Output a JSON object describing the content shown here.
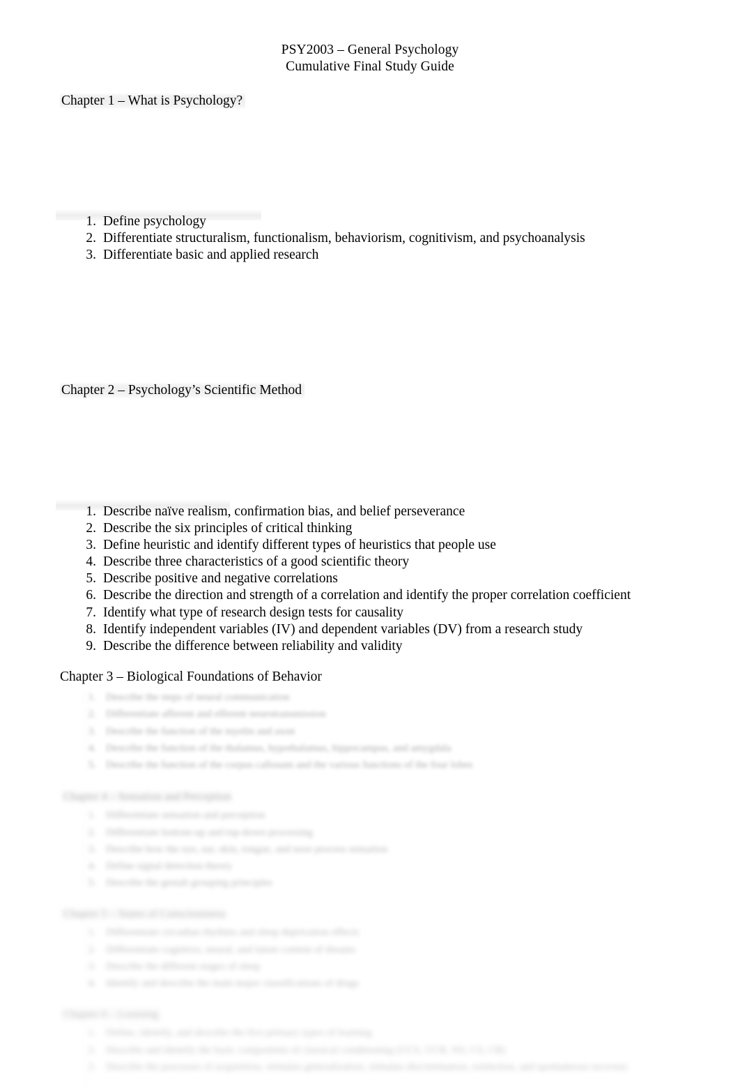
{
  "document": {
    "title_line_1": "PSY2003 – General Psychology",
    "title_line_2": "Cumulative Final Study Guide"
  },
  "chapters": [
    {
      "heading": "Chapter 1 – What is Psychology?",
      "legible": true,
      "objectives": [
        {
          "num": "1.",
          "text": "Define psychology"
        },
        {
          "num": "2.",
          "text": "Differentiate structuralism, functionalism, behaviorism, cognitivism, and psychoanalysis"
        },
        {
          "num": "3.",
          "text": "Differentiate basic and applied research"
        }
      ]
    },
    {
      "heading": "Chapter 2 – Psychology’s Scientific Method",
      "legible": true,
      "objectives": [
        {
          "num": "1.",
          "text": "Describe naïve realism, confirmation bias, and belief perseverance"
        },
        {
          "num": "2.",
          "text": "Describe the six principles of critical thinking"
        },
        {
          "num": "3.",
          "text": "Define heuristic and identify different types of heuristics that people use"
        },
        {
          "num": "4.",
          "text": "Describe three characteristics of a good scientific theory"
        },
        {
          "num": "5.",
          "text": "Describe positive and negative correlations"
        },
        {
          "num": "6.",
          "text": "Describe the direction and strength of a correlation and identify the proper correlation coefficient"
        },
        {
          "num": "7.",
          "text": "Identify what type of research design tests for causality"
        },
        {
          "num": "8.",
          "text": "Identify independent variables (IV) and dependent variables (DV) from a research study"
        },
        {
          "num": "9.",
          "text": "Describe the difference between reliability and validity"
        }
      ]
    },
    {
      "heading": "Chapter 3 – Biological Foundations of Behavior",
      "legible": true,
      "objectives_obscured": [
        {
          "num": "1.",
          "text": "Describe the steps of neural communication"
        },
        {
          "num": "2.",
          "text": "Differentiate afferent and efferent neurotransmission"
        },
        {
          "num": "3.",
          "text": "Describe the function of the myelin and axon"
        },
        {
          "num": "4.",
          "text": "Describe the function of the thalamus, hypothalamus, hippocampus, and amygdala"
        },
        {
          "num": "5.",
          "text": "Describe the function of the corpus callosum and the various functions of the four lobes"
        }
      ]
    }
  ],
  "obscured_sections": [
    {
      "heading": "Chapter 4 – Sensation and Perception",
      "items": [
        {
          "num": "1.",
          "text": "Differentiate sensation and perception"
        },
        {
          "num": "2.",
          "text": "Differentiate bottom-up and top-down processing"
        },
        {
          "num": "3.",
          "text": "Describe how the eye, ear, skin, tongue, and nose process sensation"
        },
        {
          "num": "4.",
          "text": "Define signal detection theory"
        },
        {
          "num": "5.",
          "text": "Describe the gestalt grouping principles"
        }
      ]
    },
    {
      "heading": "Chapter 5 – States of Consciousness",
      "items": [
        {
          "num": "1.",
          "text": "Differentiate circadian rhythms and sleep deprivation effects"
        },
        {
          "num": "2.",
          "text": "Differentiate cognitive, neural, and latent content of dreams"
        },
        {
          "num": "3.",
          "text": "Describe the different stages of sleep"
        },
        {
          "num": "4.",
          "text": "Identify and describe the main major classifications of drugs"
        }
      ]
    },
    {
      "heading": "Chapter 6 – Learning",
      "items": [
        {
          "num": "1.",
          "text": "Define, identify, and describe the five primary types of learning"
        },
        {
          "num": "2.",
          "text": "Describe and identify the basic components of classical conditioning (UCS, UCR, NS, CS, CR)"
        },
        {
          "num": "3.",
          "text": "Describe the processes of acquisition, stimulus generalization, stimulus discrimination, extinction, and spontaneous recovery"
        }
      ]
    }
  ],
  "rendering": {
    "note_obscured": "Content below Chapter 3 heading is visually blurred in the source document preview."
  }
}
